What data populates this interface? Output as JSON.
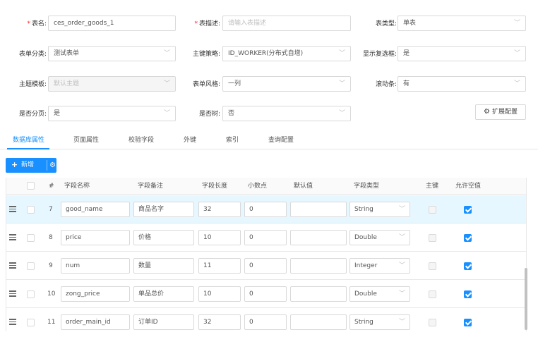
{
  "form": {
    "table_name": {
      "label": "表名:",
      "value": "ces_order_goods_1"
    },
    "table_desc": {
      "label": "表描述:",
      "placeholder": "请输入表描述"
    },
    "table_type": {
      "label": "表类型:",
      "value": "单表"
    },
    "form_category": {
      "label": "表单分类:",
      "value": "测试表单"
    },
    "pk_strategy": {
      "label": "主键策略:",
      "value": "ID_WORKER(分布式自增)"
    },
    "show_checkbox": {
      "label": "显示复选框:",
      "value": "是"
    },
    "theme_template": {
      "label": "主题模板:",
      "value": "默认主题"
    },
    "form_style": {
      "label": "表单风格:",
      "value": "一列"
    },
    "scrollbar": {
      "label": "滚动条:",
      "value": "有"
    },
    "paginate": {
      "label": "是否分页:",
      "value": "是"
    },
    "is_tree": {
      "label": "是否树:",
      "value": "否"
    },
    "extend_button": "扩展配置"
  },
  "tabs": [
    "数据库属性",
    "页面属性",
    "校验字段",
    "外键",
    "索引",
    "查询配置"
  ],
  "toolbar": {
    "add_label": "新增"
  },
  "table": {
    "headers": [
      "#",
      "字段名称",
      "字段备注",
      "字段长度",
      "小数点",
      "默认值",
      "字段类型",
      "主键",
      "允许空值"
    ],
    "rows": [
      {
        "num": "7",
        "name": "good_name",
        "remark": "商品名字",
        "length": "32",
        "decimal": "0",
        "default": "",
        "type": "String",
        "pk": false,
        "nullable": true,
        "selected": true
      },
      {
        "num": "8",
        "name": "price",
        "remark": "价格",
        "length": "10",
        "decimal": "0",
        "default": "",
        "type": "Double",
        "pk": false,
        "nullable": true,
        "selected": false
      },
      {
        "num": "9",
        "name": "num",
        "remark": "数量",
        "length": "11",
        "decimal": "0",
        "default": "",
        "type": "Integer",
        "pk": false,
        "nullable": true,
        "selected": false
      },
      {
        "num": "10",
        "name": "zong_price",
        "remark": "单品总价",
        "length": "10",
        "decimal": "0",
        "default": "",
        "type": "Double",
        "pk": false,
        "nullable": true,
        "selected": false
      },
      {
        "num": "11",
        "name": "order_main_id",
        "remark": "订单ID",
        "length": "32",
        "decimal": "0",
        "default": "",
        "type": "String",
        "pk": false,
        "nullable": true,
        "selected": false
      }
    ]
  },
  "colors": {
    "primary": "#1890ff",
    "required": "#f5222d",
    "border": "#d9d9d9",
    "selected_row": "#e6f7ff"
  }
}
